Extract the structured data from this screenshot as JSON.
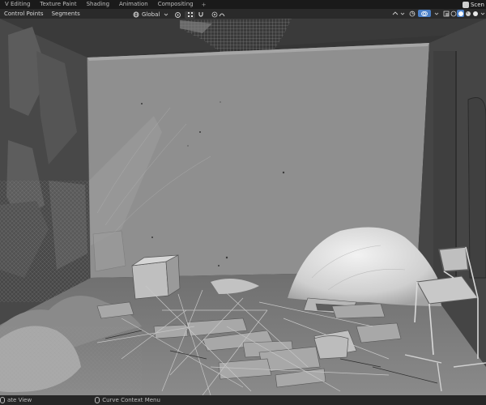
{
  "workspace_tabs": [
    "V Editing",
    "Texture Paint",
    "Shading",
    "Animation",
    "Compositing"
  ],
  "add_tab_label": "+",
  "scene_label": "Scen",
  "header": {
    "menus": [
      "Control Points",
      "Segments"
    ],
    "transform_orientation": "Global"
  },
  "status_bar": {
    "left_label": "ate View",
    "right_label": "Curve Context Menu"
  },
  "icons": {
    "orientation": "globe-icon",
    "pivot": "pivot-icon",
    "snap": "magnet-icon",
    "proportional": "proportional-edit-icon",
    "overlays": "overlay-icon",
    "shading_modes": [
      "wireframe-icon",
      "solid-icon",
      "material-icon",
      "rendered-icon"
    ]
  },
  "colors": {
    "header_bg": "#2a2a2a",
    "viewport_bg": "#363636",
    "wall": "#8e8e8e",
    "accent_blue": "#4a7fc7"
  }
}
